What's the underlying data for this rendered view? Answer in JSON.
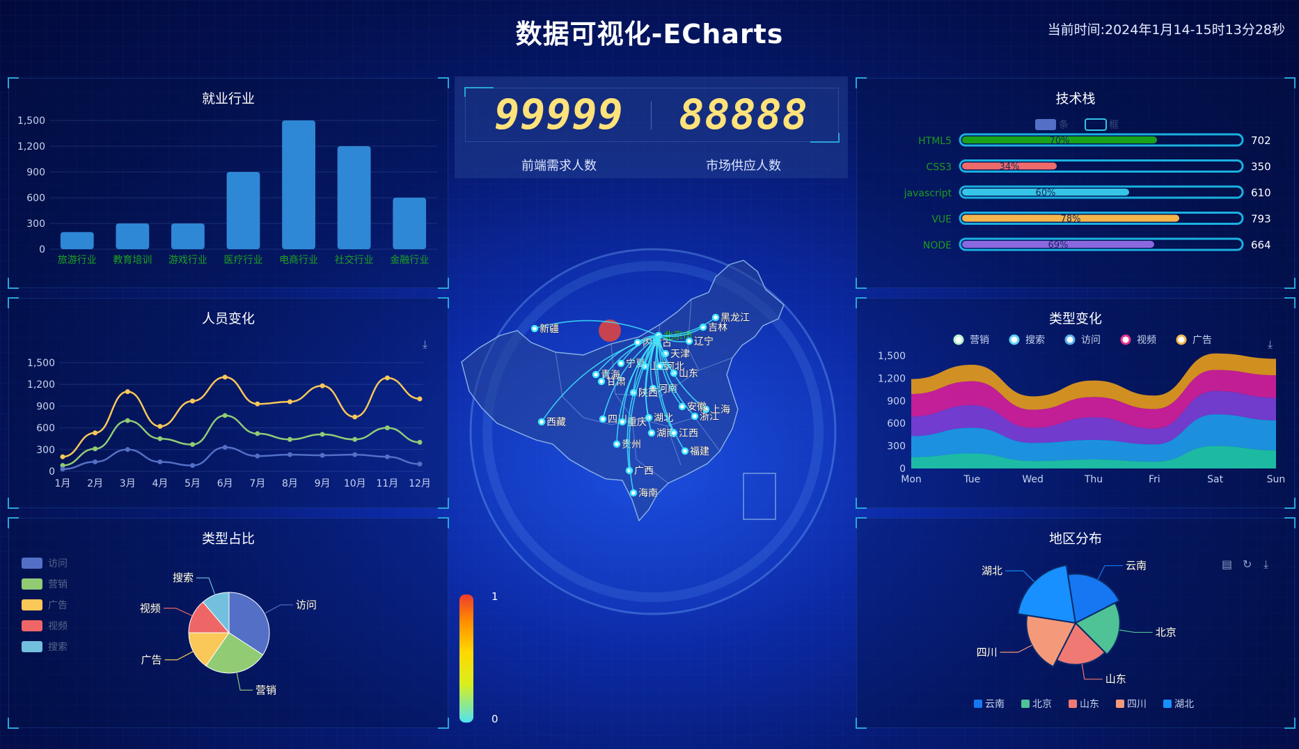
{
  "header": {
    "title": "数据可视化-ECharts",
    "time_label": "当前时间:",
    "time_value": "2024年1月14-15时13分28秒"
  },
  "counters": [
    {
      "value": "99999",
      "label": "前端需求人数"
    },
    {
      "value": "88888",
      "label": "市场供应人数"
    }
  ],
  "panels": {
    "employment": "就业行业",
    "people": "人员变化",
    "share": "类型占比",
    "tech": "技术栈",
    "type_change": "类型变化",
    "region": "地区分布"
  },
  "colors": {
    "bar": "#2f88d6",
    "purple": "#5470c6",
    "green": "#91cc75",
    "yellow": "#fac858",
    "red": "#ee6666",
    "cyan": "#73c0de"
  },
  "icons": [
    "download-icon",
    "data-view-icon",
    "restore-icon"
  ],
  "chart_data": [
    {
      "id": "employment",
      "type": "bar",
      "title": "就业行业",
      "categories": [
        "旅游行业",
        "教育培训",
        "游戏行业",
        "医疗行业",
        "电商行业",
        "社交行业",
        "金融行业"
      ],
      "values": [
        200,
        300,
        300,
        900,
        1500,
        1200,
        600
      ],
      "yticks": [
        "0",
        "300",
        "600",
        "900",
        "1,200",
        "1,500"
      ],
      "ylim": [
        0,
        1500
      ]
    },
    {
      "id": "people",
      "type": "line",
      "title": "人员变化",
      "categories": [
        "1月",
        "2月",
        "3月",
        "4月",
        "5月",
        "6月",
        "7月",
        "8月",
        "9月",
        "10月",
        "11月",
        "12月"
      ],
      "series": [
        {
          "color": "#fac858",
          "values": [
            200,
            530,
            1100,
            620,
            970,
            1300,
            930,
            960,
            1180,
            750,
            1290,
            1000
          ]
        },
        {
          "color": "#91cc75",
          "values": [
            80,
            310,
            700,
            450,
            370,
            770,
            520,
            440,
            510,
            440,
            600,
            400
          ]
        },
        {
          "color": "#5470c6",
          "values": [
            30,
            130,
            300,
            130,
            80,
            330,
            210,
            230,
            220,
            230,
            200,
            100
          ]
        }
      ],
      "yticks": [
        "0",
        "300",
        "600",
        "900",
        "1,200",
        "1,500"
      ],
      "ylim": [
        0,
        1500
      ]
    },
    {
      "id": "share",
      "type": "pie",
      "title": "类型占比",
      "legend": [
        "访问",
        "营销",
        "广告",
        "视频",
        "搜索"
      ],
      "slices": [
        {
          "name": "访问",
          "value": 335,
          "color": "#5470c6"
        },
        {
          "name": "营销",
          "value": 250,
          "color": "#91cc75"
        },
        {
          "name": "广告",
          "value": 150,
          "color": "#fac858"
        },
        {
          "name": "视频",
          "value": 135,
          "color": "#ee6666"
        },
        {
          "name": "搜索",
          "value": 110,
          "color": "#73c0de"
        }
      ]
    },
    {
      "id": "tech",
      "type": "bar",
      "title": "技术栈",
      "legend": [
        "条",
        "框"
      ],
      "categories": [
        "HTML5",
        "CSS3",
        "javascript",
        "VUE",
        "NODE"
      ],
      "percent": [
        "70%",
        "34%",
        "60%",
        "78%",
        "69%"
      ],
      "percent_values": [
        70,
        34,
        60,
        78,
        69
      ],
      "values": [
        702,
        350,
        610,
        793,
        664
      ],
      "colors": [
        "#1aa31a",
        "#ee6b6b",
        "#36c5e6",
        "#f5b54a",
        "#8a68e0"
      ]
    },
    {
      "id": "type_change",
      "type": "area",
      "title": "类型变化",
      "legend": [
        {
          "name": "营销",
          "color": "#b7f2c9"
        },
        {
          "name": "搜索",
          "color": "#5fd3f5"
        },
        {
          "name": "访问",
          "color": "#5ab1ef"
        },
        {
          "name": "视频",
          "color": "#e5358f"
        },
        {
          "name": "广告",
          "color": "#f2b84a"
        }
      ],
      "categories": [
        "Mon",
        "Tue",
        "Wed",
        "Thu",
        "Fri",
        "Sat",
        "Sun"
      ],
      "yticks": [
        "0",
        "300",
        "600",
        "900",
        "1,200",
        "1,500"
      ],
      "ylim": [
        0,
        1500
      ],
      "series": [
        {
          "name": "营销",
          "color": "#20c9a9",
          "values": [
            150,
            200,
            100,
            120,
            90,
            300,
            240
          ]
        },
        {
          "name": "搜索",
          "color": "#1e9be8",
          "values": [
            280,
            340,
            240,
            260,
            230,
            420,
            400
          ]
        },
        {
          "name": "访问",
          "color": "#7b3fd6",
          "values": [
            260,
            300,
            200,
            300,
            210,
            310,
            300
          ]
        },
        {
          "name": "视频",
          "color": "#d21f9a",
          "values": [
            300,
            320,
            240,
            270,
            260,
            280,
            300
          ]
        },
        {
          "name": "广告",
          "color": "#e39a1c",
          "values": [
            200,
            220,
            180,
            220,
            180,
            220,
            220
          ]
        }
      ]
    },
    {
      "id": "region",
      "type": "pie",
      "title": "地区分布",
      "legend": [
        "云南",
        "北京",
        "山东",
        "四川",
        "湖北"
      ],
      "slices": [
        {
          "name": "湖北",
          "value": 40,
          "color": "#1890ff"
        },
        {
          "name": "云南",
          "value": 30,
          "color": "#1677f2"
        },
        {
          "name": "北京",
          "value": 25,
          "color": "#4fc296"
        },
        {
          "name": "山东",
          "value": 22,
          "color": "#f07a73"
        },
        {
          "name": "四川",
          "value": 30,
          "color": "#f49a7a"
        }
      ]
    }
  ],
  "map": {
    "provinces": [
      {
        "name": "新疆"
      },
      {
        "name": "西藏"
      },
      {
        "name": "青海"
      },
      {
        "name": "甘肃"
      },
      {
        "name": "宁夏"
      },
      {
        "name": "内蒙古"
      },
      {
        "name": "北京市"
      },
      {
        "name": "天津"
      },
      {
        "name": "山西"
      },
      {
        "name": "河北"
      },
      {
        "name": "山东"
      },
      {
        "name": "河南"
      },
      {
        "name": "陕西"
      },
      {
        "name": "四川"
      },
      {
        "name": "重庆"
      },
      {
        "name": "湖北"
      },
      {
        "name": "湖南"
      },
      {
        "name": "贵州"
      },
      {
        "name": "广西"
      },
      {
        "name": "海南"
      },
      {
        "name": "福建"
      },
      {
        "name": "江西"
      },
      {
        "name": "浙江"
      },
      {
        "name": "上海"
      },
      {
        "name": "安徽"
      },
      {
        "name": "辽宁"
      },
      {
        "name": "吉林"
      },
      {
        "name": "黑龙江"
      }
    ],
    "visual_map": {
      "max": "1",
      "min": "0"
    }
  }
}
